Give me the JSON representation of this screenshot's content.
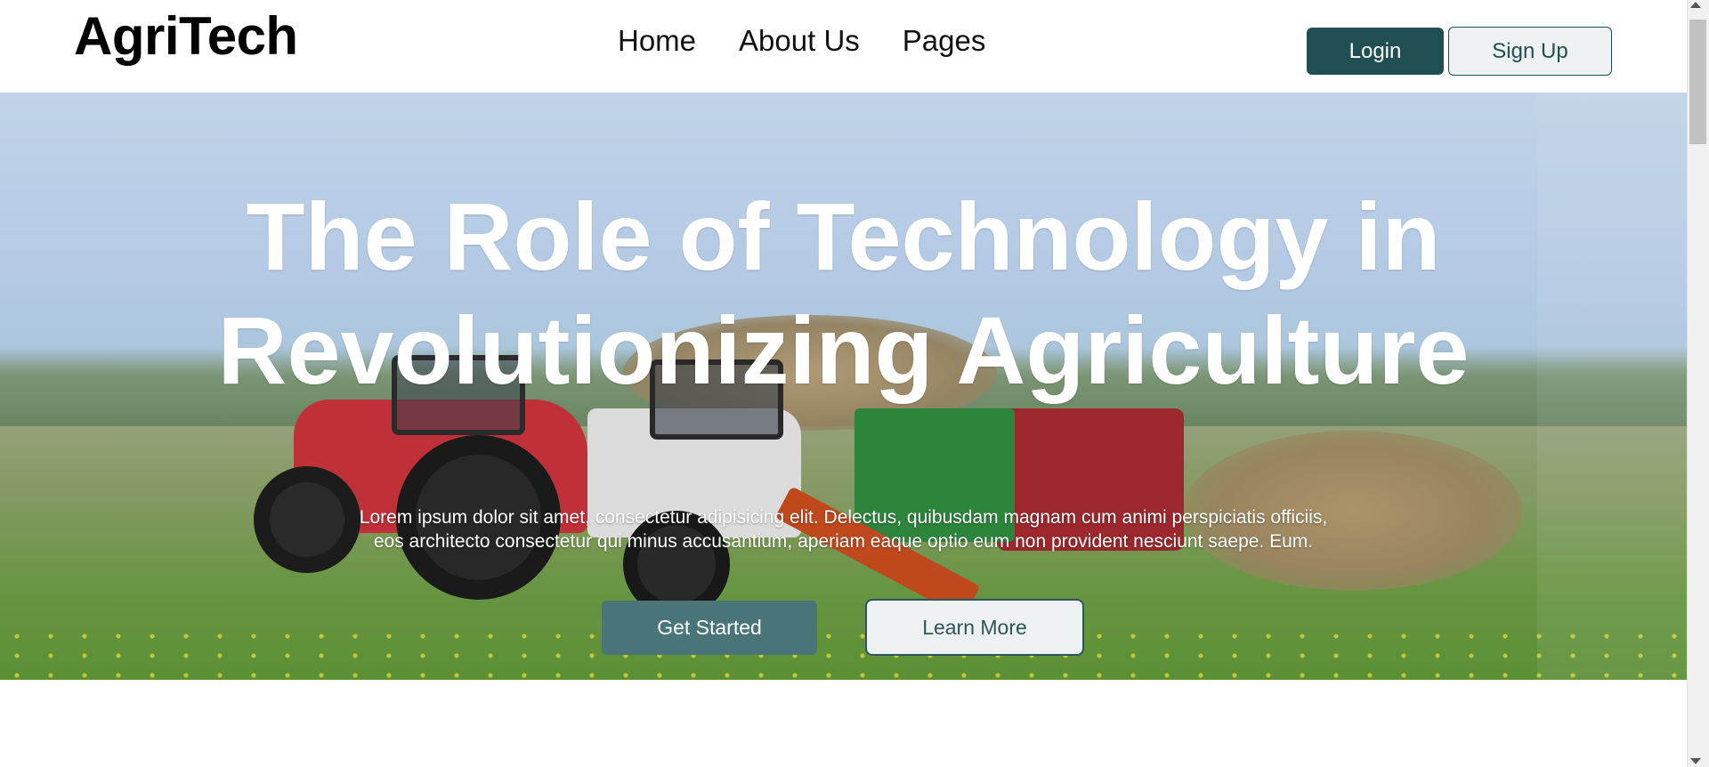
{
  "header": {
    "logo": "AgriTech",
    "nav": [
      "Home",
      "About Us",
      "Pages"
    ],
    "login_label": "Login",
    "signup_label": "Sign Up"
  },
  "hero": {
    "title_line1": "The Role of Technology in",
    "title_line2": "Revolutionizing Agriculture",
    "description": "Lorem ipsum dolor sit amet, consectetur adipisicing elit. Delectus, quibusdam magnam cum animi perspiciatis officiis, eos architecto consectetur qui minus accusantium, aperiam eaque optio eum non provident nesciunt saepe. Eum.",
    "primary_button": "Get Started",
    "secondary_button": "Learn More"
  },
  "colors": {
    "brand_dark": "#1f4f51",
    "button_teal": "#4a7578"
  }
}
